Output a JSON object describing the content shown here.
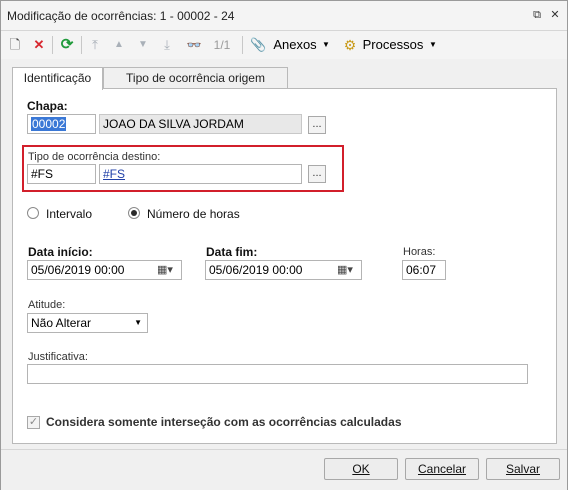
{
  "window": {
    "title": "Modificação de ocorrências: 1 - 00002 - 24",
    "restore_glyph": "⧉",
    "close_glyph": "✕"
  },
  "toolbar": {
    "new_glyph": "🗋",
    "delete_glyph": "✕",
    "refresh_glyph": "⟳",
    "first_glyph": "⤒",
    "prev_glyph": "▲",
    "next_glyph": "▼",
    "last_glyph": "⤓",
    "binoculars_glyph": "👓",
    "record_counter": "1/1",
    "attachments_glyph": "📎",
    "attachments_label": "Anexos",
    "processes_glyph": "⚙",
    "processes_label": "Processos",
    "dropdown_glyph": "▼"
  },
  "tabs": [
    {
      "label": "Identificação",
      "active": true
    },
    {
      "label": "Tipo de ocorrência origem",
      "active": false
    }
  ],
  "form": {
    "chapa_label": "Chapa:",
    "chapa_code": "00002",
    "chapa_name": "JOAO DA SILVA JORDAM",
    "lookup_glyph": "...",
    "tipo_destino_label": "Tipo de ocorrência destino:",
    "tipo_destino_code": "#FS",
    "tipo_destino_desc": "#FS",
    "radio_intervalo": "Intervalo",
    "radio_horas": "Número de horas",
    "selected_radio": "Número de horas",
    "data_inicio_label": "Data início:",
    "data_inicio_value": "05/06/2019 00:00",
    "data_fim_label": "Data fim:",
    "data_fim_value": "05/06/2019 00:00",
    "calendar_glyph": "▦▾",
    "horas_label": "Horas:",
    "horas_value": "06:07",
    "atitude_label": "Atitude:",
    "atitude_value": "Não Alterar",
    "select_glyph": "▼",
    "justificativa_label": "Justificativa:",
    "justificativa_value": "",
    "considera_label": "Considera somente interseção com as ocorrências calculadas",
    "considera_checked": true,
    "check_glyph": "✓"
  },
  "buttons": {
    "ok": "OK",
    "cancelar": "Cancelar",
    "salvar": "Salvar"
  },
  "colors": {
    "highlight_border": "#d21f2b",
    "selection": "#3a78d6",
    "link": "#1f3fa8",
    "delete_red": "#d7262e",
    "refresh_green": "#1f9a3a"
  }
}
